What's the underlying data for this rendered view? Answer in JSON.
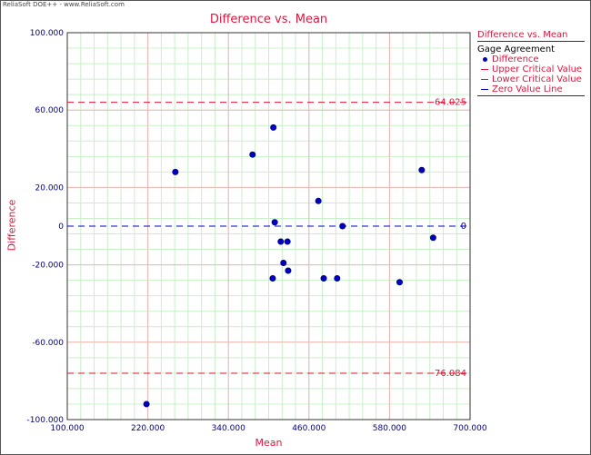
{
  "brand": "ReliaSoft DOE++ - www.ReliaSoft.com",
  "chart_data": {
    "type": "scatter",
    "title": "Difference vs. Mean",
    "xlabel": "Mean",
    "ylabel": "Difference",
    "xlim": [
      100,
      700
    ],
    "ylim": [
      -100,
      100
    ],
    "xticks": [
      "100.000",
      "220.000",
      "340.000",
      "460.000",
      "580.000",
      "700.000"
    ],
    "yticks": [
      "100.000",
      "60.000",
      "20.000",
      "0",
      "-20.000",
      "-60.000",
      "-100.000"
    ],
    "grid": true,
    "series": [
      {
        "name": "Difference",
        "points": [
          [
            218,
            -92
          ],
          [
            261,
            28
          ],
          [
            376,
            37
          ],
          [
            406,
            -27
          ],
          [
            407,
            51
          ],
          [
            409,
            2
          ],
          [
            418,
            -8
          ],
          [
            422,
            -19
          ],
          [
            428,
            -8
          ],
          [
            429,
            -23
          ],
          [
            474,
            13
          ],
          [
            482,
            -27
          ],
          [
            502,
            -27
          ],
          [
            510,
            0
          ],
          [
            595,
            -29
          ],
          [
            628,
            29
          ],
          [
            645,
            -6
          ]
        ]
      }
    ],
    "reference_lines": [
      {
        "name": "Upper Critical Value",
        "value": 64.025,
        "label": "64.025",
        "color": "#e0143c"
      },
      {
        "name": "Lower Critical Value",
        "value": -76.084,
        "label": "-76.084",
        "color": "#e0143c"
      },
      {
        "name": "Zero Value Line",
        "value": 0,
        "label": "0",
        "color": "#0000c0"
      }
    ],
    "legend": {
      "title": "Difference vs. Mean",
      "subtitle": "Gage Agreement",
      "entries": [
        "Difference",
        "Upper Critical Value",
        "Lower Critical Value",
        "Zero Value Line"
      ],
      "placement": "right"
    },
    "colors": {
      "primary": "#e0143c",
      "points": "#0000c0",
      "minor_grid": "#c8f0c8",
      "major_grid": "#f0b4b4",
      "tick_text": "#000080"
    }
  }
}
